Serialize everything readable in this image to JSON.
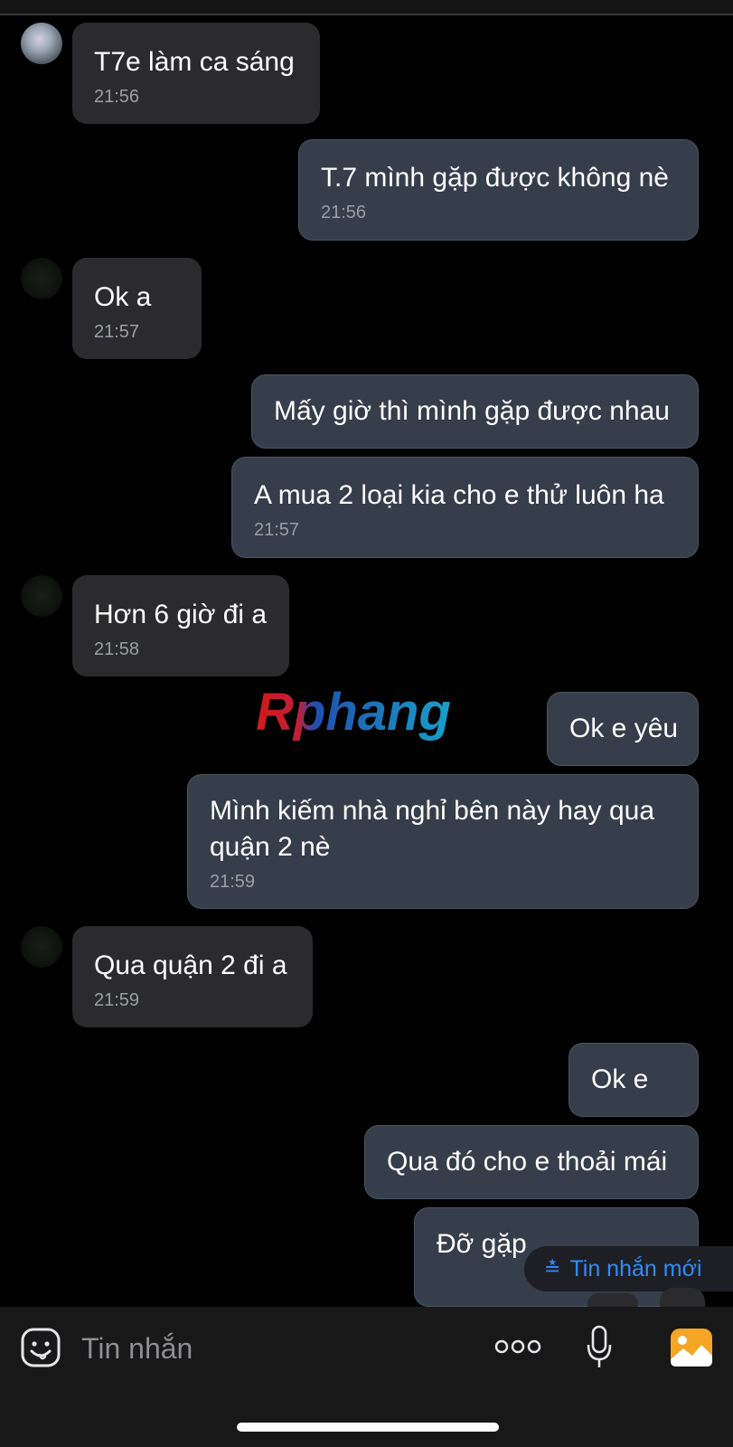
{
  "watermark": "Rphang",
  "messages": [
    {
      "side": "in",
      "text": "T7e làm ca sáng",
      "time": "21:56"
    },
    {
      "side": "out",
      "text": "T.7 mình gặp được không nè",
      "time": "21:56"
    },
    {
      "side": "in",
      "text": "Ok a",
      "time": "21:57"
    },
    {
      "side": "out",
      "text": "Mấy giờ thì mình gặp được nhau"
    },
    {
      "side": "out",
      "text": "A mua 2 loại kia cho e thử luôn ha",
      "time": "21:57"
    },
    {
      "side": "in",
      "text": "Hơn 6 giờ đi a",
      "time": "21:58"
    },
    {
      "side": "out",
      "text": "Ok e yêu"
    },
    {
      "side": "out",
      "text": "Mình kiếm nhà nghỉ bên này hay qua quận 2 nè",
      "time": "21:59"
    },
    {
      "side": "in",
      "text": "Qua quận 2 đi a",
      "time": "21:59"
    },
    {
      "side": "out",
      "text": "Ok e"
    },
    {
      "side": "out",
      "text": "Qua đó cho e thoải mái"
    },
    {
      "side": "out",
      "text": "Đỡ gặp"
    }
  ],
  "new_messages_button": "Tin nhắn mới",
  "composer": {
    "placeholder": "Tin nhắn",
    "icons": [
      "sticker-icon",
      "more-icon",
      "microphone-icon",
      "photo-icon"
    ]
  },
  "colors": {
    "background": "#000000",
    "incoming_bubble": "#2b2b2d",
    "outgoing_bubble": "#353e4a",
    "accent": "#2f8cff",
    "photo_icon": "#f6a524"
  }
}
